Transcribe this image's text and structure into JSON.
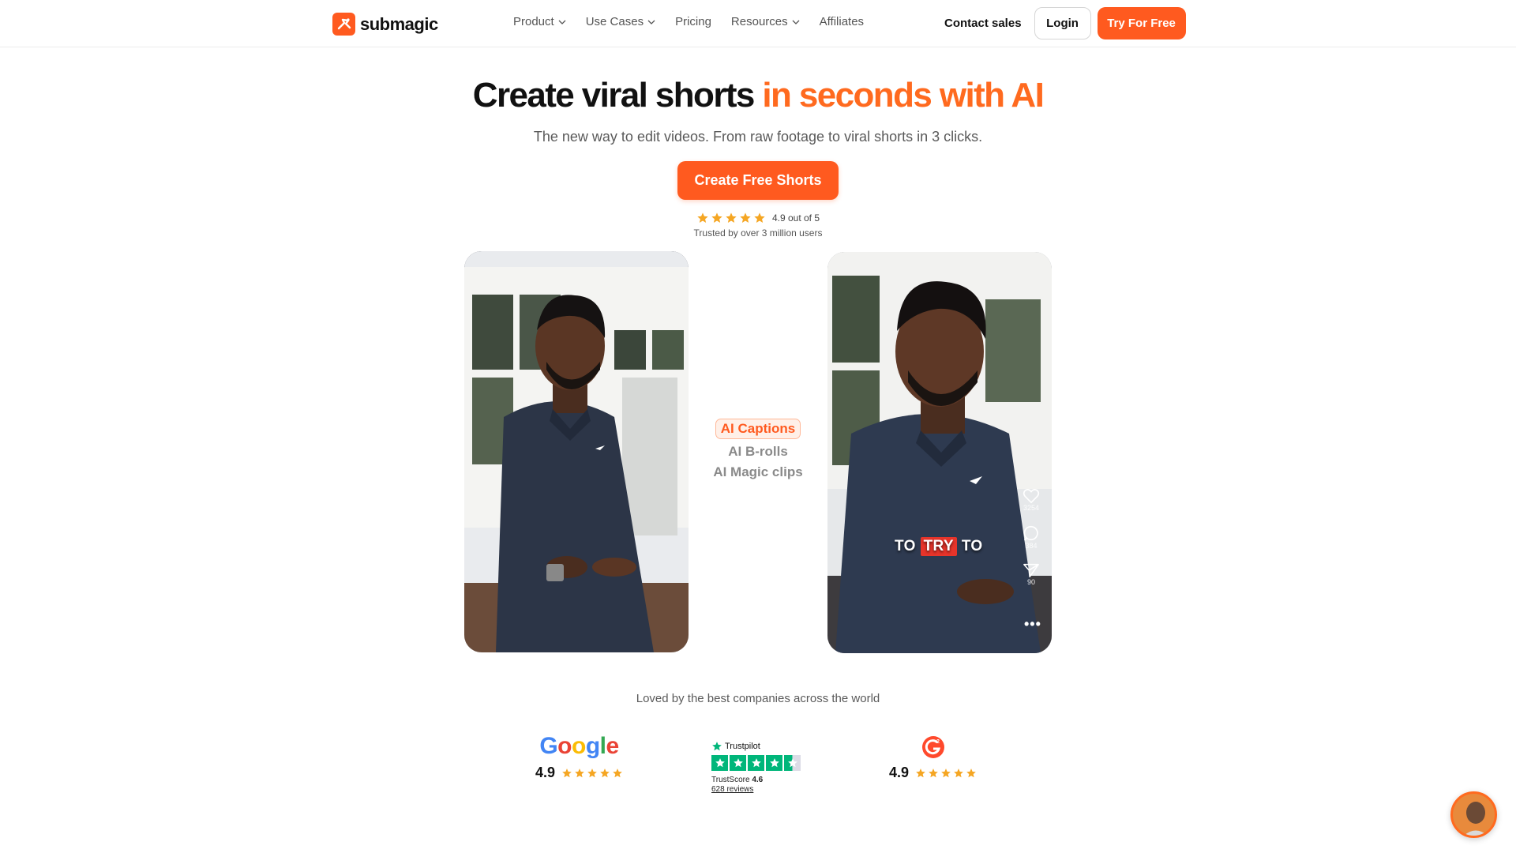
{
  "nav": {
    "logo_text": "submagic",
    "menu": [
      {
        "label": "Product"
      },
      {
        "label": "Use Cases"
      },
      {
        "label": "Pricing"
      },
      {
        "label": "Resources"
      },
      {
        "label": "Affiliates"
      }
    ],
    "contact_label": "Contact sales",
    "login_label": "Login",
    "try_label": "Try For Free"
  },
  "hero": {
    "headline_main": "Create viral shorts ",
    "headline_accent": "in seconds with AI",
    "subhead": "The new way to edit videos. From raw footage to viral shorts in 3 clicks.",
    "cta_label": "Create Free Shorts",
    "rating_text": "4.9 out of 5",
    "trusted_text": "Trusted by over 3 million users"
  },
  "video": {
    "caption_words": [
      "TO",
      "TRY",
      "TO"
    ],
    "likes": "3254",
    "comments": "384",
    "shares": "90",
    "features": [
      "AI Captions",
      "AI B-rolls",
      "AI Magic clips"
    ]
  },
  "social_proof": {
    "heading": "Loved by the best companies across the world",
    "google": {
      "logo": "Google",
      "score": "4.9"
    },
    "trustpilot": {
      "logo": "Trustpilot",
      "trustscore_label": "TrustScore",
      "trustscore": "4.6",
      "reviews": "628 reviews"
    },
    "g2": {
      "score": "4.9"
    }
  },
  "colors": {
    "accent": "#ff5a1f",
    "trustpilot_green": "#00b67a",
    "star_gold": "#f5a623"
  }
}
